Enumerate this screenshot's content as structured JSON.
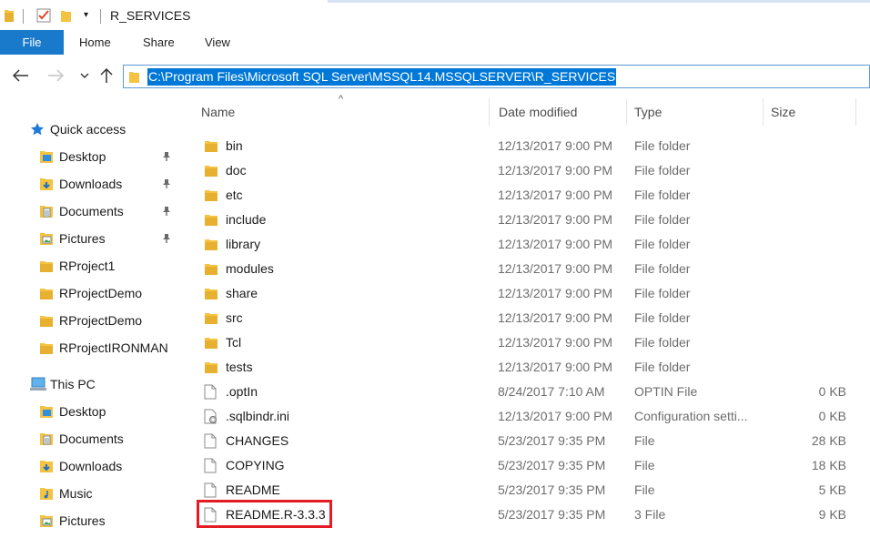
{
  "window": {
    "title": "R_SERVICES",
    "qat": [
      "folder-icon",
      "properties-checkmark-icon",
      "new-folder-icon",
      "customize-dropdown-icon"
    ]
  },
  "ribbon": {
    "file_label": "File",
    "tabs": [
      "Home",
      "Share",
      "View"
    ]
  },
  "nav": {
    "back": "back-arrow-icon",
    "forward": "forward-arrow-icon",
    "recent": "recent-dropdown-icon",
    "up": "up-arrow-icon",
    "address": "C:\\Program Files\\Microsoft SQL Server\\MSSQL14.MSSQLSERVER\\R_SERVICES"
  },
  "sidebar": {
    "quick_access": {
      "label": "Quick access",
      "items": [
        {
          "label": "Desktop",
          "icon": "desktop-folder-icon",
          "pinned": true
        },
        {
          "label": "Downloads",
          "icon": "downloads-folder-icon",
          "pinned": true
        },
        {
          "label": "Documents",
          "icon": "documents-folder-icon",
          "pinned": true
        },
        {
          "label": "Pictures",
          "icon": "pictures-folder-icon",
          "pinned": true
        },
        {
          "label": "RProject1",
          "icon": "folder-icon",
          "pinned": false
        },
        {
          "label": "RProjectDemo",
          "icon": "folder-icon",
          "pinned": false
        },
        {
          "label": "RProjectDemo",
          "icon": "folder-icon",
          "pinned": false
        },
        {
          "label": "RProjectIRONMAN",
          "icon": "folder-icon",
          "pinned": false
        }
      ]
    },
    "this_pc": {
      "label": "This PC",
      "items": [
        {
          "label": "Desktop",
          "icon": "desktop-folder-icon"
        },
        {
          "label": "Documents",
          "icon": "documents-folder-icon"
        },
        {
          "label": "Downloads",
          "icon": "downloads-folder-icon"
        },
        {
          "label": "Music",
          "icon": "music-folder-icon"
        },
        {
          "label": "Pictures",
          "icon": "pictures-folder-icon"
        }
      ]
    }
  },
  "columns": {
    "name": "Name",
    "date": "Date modified",
    "type": "Type",
    "size": "Size"
  },
  "files": [
    {
      "name": "bin",
      "date": "12/13/2017 9:00 PM",
      "type": "File folder",
      "size": "",
      "icon": "folder-icon"
    },
    {
      "name": "doc",
      "date": "12/13/2017 9:00 PM",
      "type": "File folder",
      "size": "",
      "icon": "folder-icon"
    },
    {
      "name": "etc",
      "date": "12/13/2017 9:00 PM",
      "type": "File folder",
      "size": "",
      "icon": "folder-icon"
    },
    {
      "name": "include",
      "date": "12/13/2017 9:00 PM",
      "type": "File folder",
      "size": "",
      "icon": "folder-icon"
    },
    {
      "name": "library",
      "date": "12/13/2017 9:00 PM",
      "type": "File folder",
      "size": "",
      "icon": "folder-icon"
    },
    {
      "name": "modules",
      "date": "12/13/2017 9:00 PM",
      "type": "File folder",
      "size": "",
      "icon": "folder-icon"
    },
    {
      "name": "share",
      "date": "12/13/2017 9:00 PM",
      "type": "File folder",
      "size": "",
      "icon": "folder-icon"
    },
    {
      "name": "src",
      "date": "12/13/2017 9:00 PM",
      "type": "File folder",
      "size": "",
      "icon": "folder-icon"
    },
    {
      "name": "Tcl",
      "date": "12/13/2017 9:00 PM",
      "type": "File folder",
      "size": "",
      "icon": "folder-icon"
    },
    {
      "name": "tests",
      "date": "12/13/2017 9:00 PM",
      "type": "File folder",
      "size": "",
      "icon": "folder-icon"
    },
    {
      "name": ".optIn",
      "date": "8/24/2017 7:10 AM",
      "type": "OPTIN File",
      "size": "0 KB",
      "icon": "file-icon"
    },
    {
      "name": ".sqlbindr.ini",
      "date": "12/13/2017 9:00 PM",
      "type": "Configuration setti...",
      "size": "0 KB",
      "icon": "config-file-icon"
    },
    {
      "name": "CHANGES",
      "date": "5/23/2017 9:35 PM",
      "type": "File",
      "size": "28 KB",
      "icon": "file-icon"
    },
    {
      "name": "COPYING",
      "date": "5/23/2017 9:35 PM",
      "type": "File",
      "size": "18 KB",
      "icon": "file-icon"
    },
    {
      "name": "README",
      "date": "5/23/2017 9:35 PM",
      "type": "File",
      "size": "5 KB",
      "icon": "file-icon"
    },
    {
      "name": "README.R-3.3.3",
      "date": "5/23/2017 9:35 PM",
      "type": "3 File",
      "size": "9 KB",
      "icon": "file-icon",
      "highlighted": true
    }
  ],
  "colors": {
    "accent": "#1979ca",
    "selection": "#0078d7",
    "highlight_box": "#e31b23",
    "folder": "#f5c342"
  }
}
